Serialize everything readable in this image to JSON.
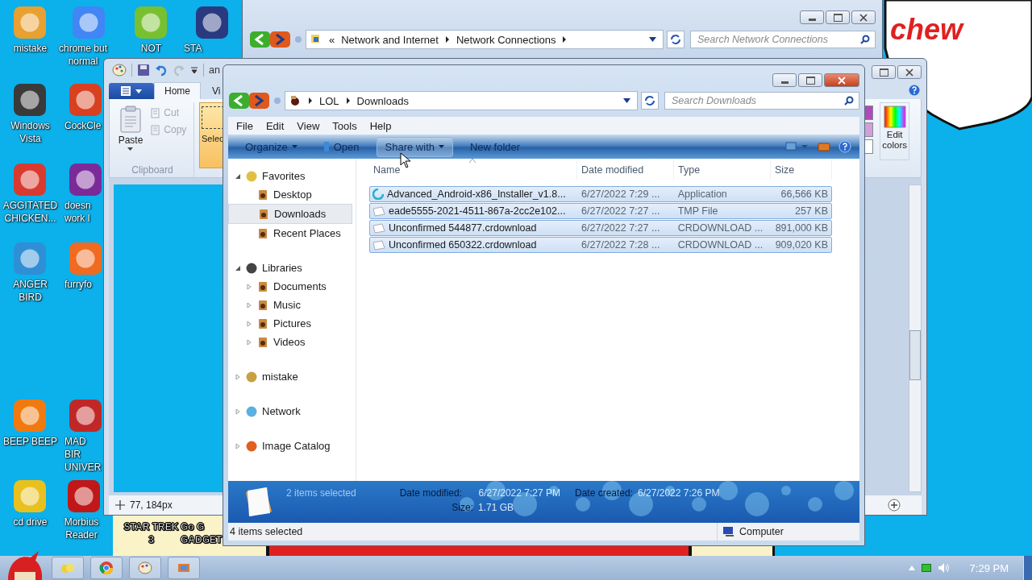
{
  "desktop_icons": [
    {
      "label": "mistake"
    },
    {
      "label": "Windows\nVista"
    },
    {
      "label": "AGGITATED\nCHICKEN..."
    },
    {
      "label": "ANGER\nBIRD"
    },
    {
      "label": "BEEP BEEP"
    },
    {
      "label": "cd drive"
    },
    {
      "label": "chrome but\nnormal"
    },
    {
      "label": "CockCle"
    },
    {
      "label": "doesn\nwork l"
    },
    {
      "label": "furryfo"
    },
    {
      "label": "MAD BIR\nUNIVER"
    },
    {
      "label": "Morbius\nReader"
    },
    {
      "label": "NOT"
    },
    {
      "label": "STA"
    },
    {
      "label": "STAR TREK\n3"
    },
    {
      "label": "Go G\nGADGET"
    }
  ],
  "network_window": {
    "back_glyph": "«",
    "path": [
      "Network and Internet",
      "Network Connections"
    ],
    "search_placeholder": "Search Network Connections"
  },
  "paint_window": {
    "title": "an",
    "tabs": [
      {
        "label": "Home",
        "selected": true
      },
      {
        "label": "Vi",
        "selected": false
      }
    ],
    "paste": "Paste",
    "small_buttons": [
      {
        "label": "Cut",
        "disabled": true
      },
      {
        "label": "Copy",
        "disabled": true
      }
    ],
    "group_label": "Clipboard",
    "select": {
      "label": "Selec",
      "selected": true
    },
    "edit_colors": "Edit\ncolors",
    "position": "77, 184px"
  },
  "explorer": {
    "path": [
      "LOL",
      "Downloads"
    ],
    "search_placeholder": "Search Downloads",
    "menu": [
      "File",
      "Edit",
      "View",
      "Tools",
      "Help"
    ],
    "toolbar": [
      {
        "label": "Organize",
        "kind": "dropdown",
        "hover": false
      },
      {
        "label": "Open",
        "kind": "open",
        "hover": false
      },
      {
        "label": "Share with",
        "kind": "dropdown",
        "hover": true
      },
      {
        "label": "New folder",
        "kind": "plain",
        "hover": false
      }
    ],
    "nav": [
      {
        "label": "Favorites",
        "expanded": true,
        "selected": false,
        "children": [
          {
            "label": "Desktop",
            "selected": false
          },
          {
            "label": "Downloads",
            "selected": true
          },
          {
            "label": "Recent Places",
            "selected": false
          }
        ]
      },
      {
        "label": "Libraries",
        "expanded": true,
        "selected": false,
        "children": [
          {
            "label": "Documents",
            "expanded": false,
            "selected": false
          },
          {
            "label": "Music",
            "expanded": false,
            "selected": false
          },
          {
            "label": "Pictures",
            "expanded": false,
            "selected": false
          },
          {
            "label": "Videos",
            "expanded": false,
            "selected": false
          }
        ]
      },
      {
        "label": "mistake",
        "expanded": false,
        "selected": false
      },
      {
        "label": "Network",
        "expanded": false,
        "selected": false
      },
      {
        "label": "Image Catalog",
        "expanded": false,
        "selected": false
      }
    ],
    "columns": [
      "Name",
      "Date modified",
      "Type",
      "Size"
    ],
    "rows": [
      {
        "kind": "application",
        "name": "Advanced_Android-x86_Installer_v1.8...",
        "date": "6/27/2022 7:29 ...",
        "type": "Application",
        "size": "66,566 KB",
        "selected": true
      },
      {
        "kind": "file",
        "name": "eade5555-2021-4511-867a-2cc2e102...",
        "date": "6/27/2022 7:27 ...",
        "type": "TMP File",
        "size": "257 KB",
        "selected": true
      },
      {
        "kind": "file",
        "name": "Unconfirmed 544877.crdownload",
        "date": "6/27/2022 7:27 ...",
        "type": "CRDOWNLOAD ...",
        "size": "891,000 KB",
        "selected": true
      },
      {
        "kind": "file",
        "name": "Unconfirmed 650322.crdownload",
        "date": "6/27/2022 7:28 ...",
        "type": "CRDOWNLOAD ...",
        "size": "909,020 KB",
        "selected": true
      }
    ],
    "details": {
      "summary": "2 items selected",
      "modified_label": "Date modified:",
      "modified": "6/27/2022 7:27 PM",
      "created_label": "Date created:",
      "created": "6/27/2022 7:26 PM",
      "size_label": "Size:",
      "size": "1.71 GB"
    },
    "status": "4 items selected",
    "zone": "Computer"
  },
  "bubble_text": "chew",
  "taskbar": {
    "clock": "7:29 PM"
  }
}
